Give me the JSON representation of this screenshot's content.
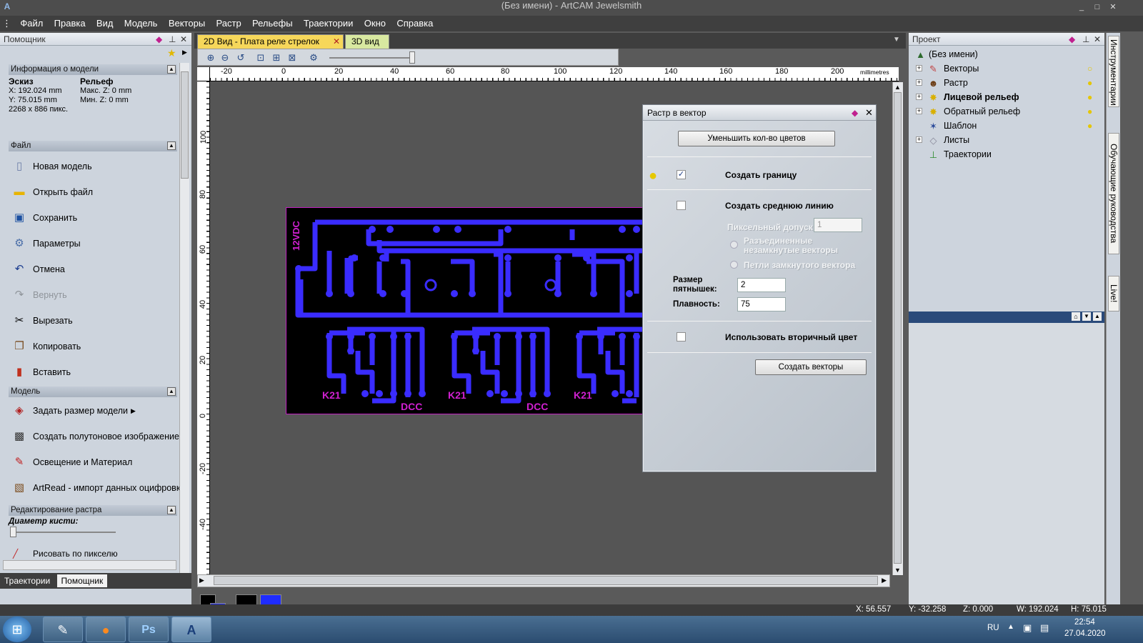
{
  "window": {
    "title": "(Без имени) - ArtCAM Jewelsmith"
  },
  "menu": [
    "Файл",
    "Правка",
    "Вид",
    "Модель",
    "Векторы",
    "Растр",
    "Рельефы",
    "Траектории",
    "Окно",
    "Справка"
  ],
  "left_panel": {
    "title": "Помощник",
    "model_info": {
      "header": "Информация о модели",
      "sketch_label": "Эскиз",
      "relief_label": "Рельеф",
      "x": "X: 192.024 mm",
      "y": "Y: 75.015 mm",
      "pixels": "2268 x 886 пикс.",
      "max_z": "Макс. Z: 0 mm",
      "min_z": "Мин. Z: 0 mm"
    },
    "file_section": {
      "header": "Файл",
      "items": [
        {
          "label": "Новая модель",
          "icon": "new-model-icon"
        },
        {
          "label": "Открыть файл",
          "icon": "open-folder-icon"
        },
        {
          "label": "Сохранить",
          "icon": "save-icon"
        },
        {
          "label": "Параметры",
          "icon": "parameters-icon"
        },
        {
          "label": "Отмена",
          "icon": "undo-icon"
        },
        {
          "label": "Вернуть",
          "icon": "redo-icon"
        },
        {
          "label": "Вырезать",
          "icon": "scissors-icon"
        },
        {
          "label": "Копировать",
          "icon": "copy-icon"
        },
        {
          "label": "Вставить",
          "icon": "paste-icon"
        }
      ]
    },
    "model_section": {
      "header": "Модель",
      "items": [
        {
          "label": "Задать размер модели",
          "icon": "model-size-icon"
        },
        {
          "label": "Создать полутоновое изображение",
          "icon": "grayscale-icon"
        },
        {
          "label": "Освещение и Материал",
          "icon": "lighting-icon"
        },
        {
          "label": "ArtRead - импорт данных оцифровки",
          "icon": "artread-icon"
        }
      ]
    },
    "raster_section": {
      "header": "Редактирование растра",
      "brush_label": "Диаметр кисти:",
      "draw_pixel": "Рисовать по пикселю"
    },
    "tabs": [
      "Траектории",
      "Помощник"
    ]
  },
  "document": {
    "tabs": [
      "2D Вид - Плата реле стрелок",
      "3D вид"
    ],
    "ruler_unit": "millimetres",
    "h_ruler": [
      "-20",
      "0",
      "20",
      "40",
      "60",
      "80",
      "100",
      "120",
      "140",
      "160",
      "180",
      "200"
    ],
    "v_ruler": [
      "100",
      "80",
      "60",
      "40",
      "20",
      "0",
      "-20",
      "-40"
    ],
    "pcb_labels": {
      "voltage": "12VDC",
      "k": "K21",
      "dcc": "DCC"
    }
  },
  "dialog": {
    "title": "Растр в вектор",
    "reduce_colors": "Уменьшить кол-во цветов",
    "create_border": "Создать границу",
    "create_centerline": "Создать среднюю линию",
    "pixel_tolerance": "Пиксельный допуск",
    "pixel_tolerance_value": "1",
    "open_vectors": "Разъединенные незамкнутые векторы",
    "closed_loops": "Петли замкнутого вектора",
    "spot_size_label": "Размер пятнышек:",
    "spot_size_value": "2",
    "smoothness_label": "Плавность:",
    "smoothness_value": "75",
    "secondary_color": "Использовать вторичный цвет",
    "create_vectors": "Создать векторы",
    "create_border_checked": true,
    "create_centerline_checked": false,
    "secondary_color_checked": false
  },
  "project": {
    "title": "Проект",
    "root": "(Без имени)",
    "items": [
      {
        "label": "Векторы",
        "icon": "vectors-icon",
        "bold": false
      },
      {
        "label": "Растр",
        "icon": "raster-icon",
        "bold": false
      },
      {
        "label": "Лицевой рельеф",
        "icon": "relief-front-icon",
        "bold": true
      },
      {
        "label": "Обратный рельеф",
        "icon": "relief-back-icon",
        "bold": false
      },
      {
        "label": "Шаблон",
        "icon": "template-icon",
        "bold": false
      },
      {
        "label": "Листы",
        "icon": "sheets-icon",
        "bold": false
      },
      {
        "label": "Траектории",
        "icon": "toolpaths-icon",
        "bold": false
      }
    ]
  },
  "side_tabs": [
    "Инструментарии",
    "Обучающие руководства",
    "Live!"
  ],
  "status": {
    "x": "X: 56.557",
    "y": "Y: -32.258",
    "z": "Z: 0.000",
    "w": "W: 192.024",
    "h": "H: 75.015"
  },
  "taskbar": {
    "lang": "RU",
    "time": "22:54",
    "date": "27.04.2020",
    "apps": [
      "notepad",
      "firefox",
      "photoshop",
      "artcam"
    ]
  },
  "colors": {
    "pcb_trace": "#3a2cff",
    "pcb_outline": "#d020d0",
    "accent_tab": "#f6d75a"
  }
}
